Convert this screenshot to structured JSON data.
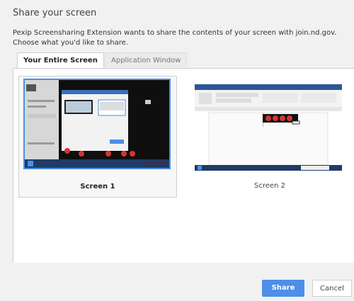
{
  "dialog": {
    "title": "Share your screen",
    "description": "Pexip Screensharing Extension wants to share the contents of your screen with join.nd.gov. Choose what you'd like to share."
  },
  "tabs": [
    {
      "label": "Your Entire Screen",
      "active": true
    },
    {
      "label": "Application Window",
      "active": false
    }
  ],
  "sources": [
    {
      "label": "Screen 1",
      "selected": true
    },
    {
      "label": "Screen 2",
      "selected": false
    }
  ],
  "buttons": {
    "share": "Share",
    "cancel": "Cancel"
  },
  "colors": {
    "accent": "#4d8fe8",
    "dialog_bg": "#f1f1f1"
  }
}
